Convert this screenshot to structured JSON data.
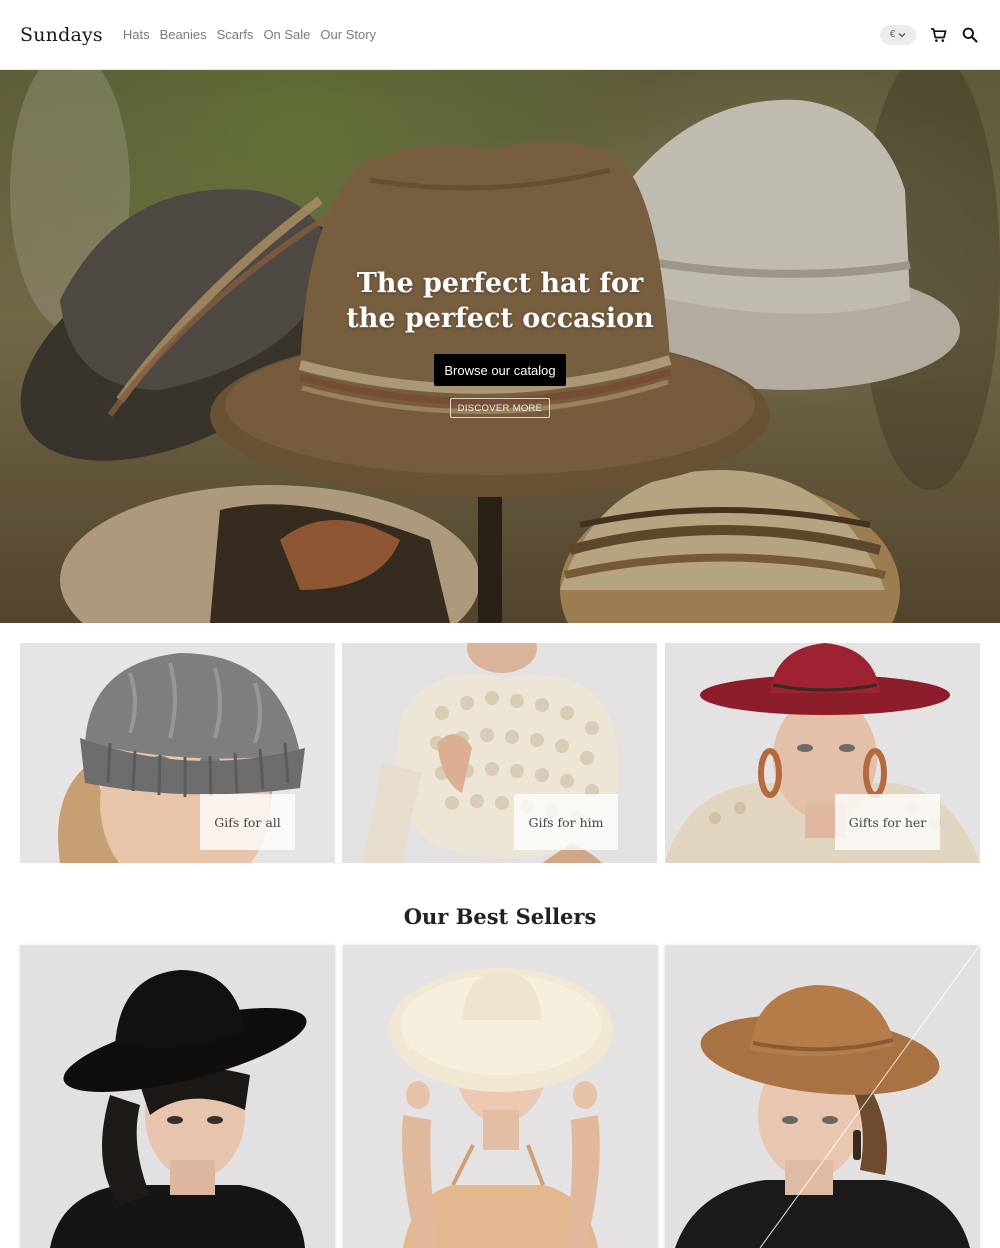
{
  "header": {
    "logo": "Sundays",
    "nav": [
      {
        "label": "Hats"
      },
      {
        "label": "Beanies"
      },
      {
        "label": "Scarfs"
      },
      {
        "label": "On Sale"
      },
      {
        "label": "Our Story"
      }
    ],
    "currency": "€",
    "icons": [
      "chevron-down-icon",
      "cart-icon",
      "search-icon"
    ]
  },
  "hero": {
    "title_line1": "The perfect hat for",
    "title_line2": "the perfect occasion",
    "cta_label": "Browse our catalog",
    "secondary_label": "DISCOVER MORE"
  },
  "categories": [
    {
      "label": "Gifs for all"
    },
    {
      "label": "Gifs for him"
    },
    {
      "label": "Gifts for her"
    }
  ],
  "best_sellers": {
    "title": "Our Best Sellers"
  },
  "colors": {
    "accent": "#000000",
    "nav_text": "#7a7a7a",
    "red_hat": "#9e2232",
    "tan_hat": "#b07a48"
  }
}
